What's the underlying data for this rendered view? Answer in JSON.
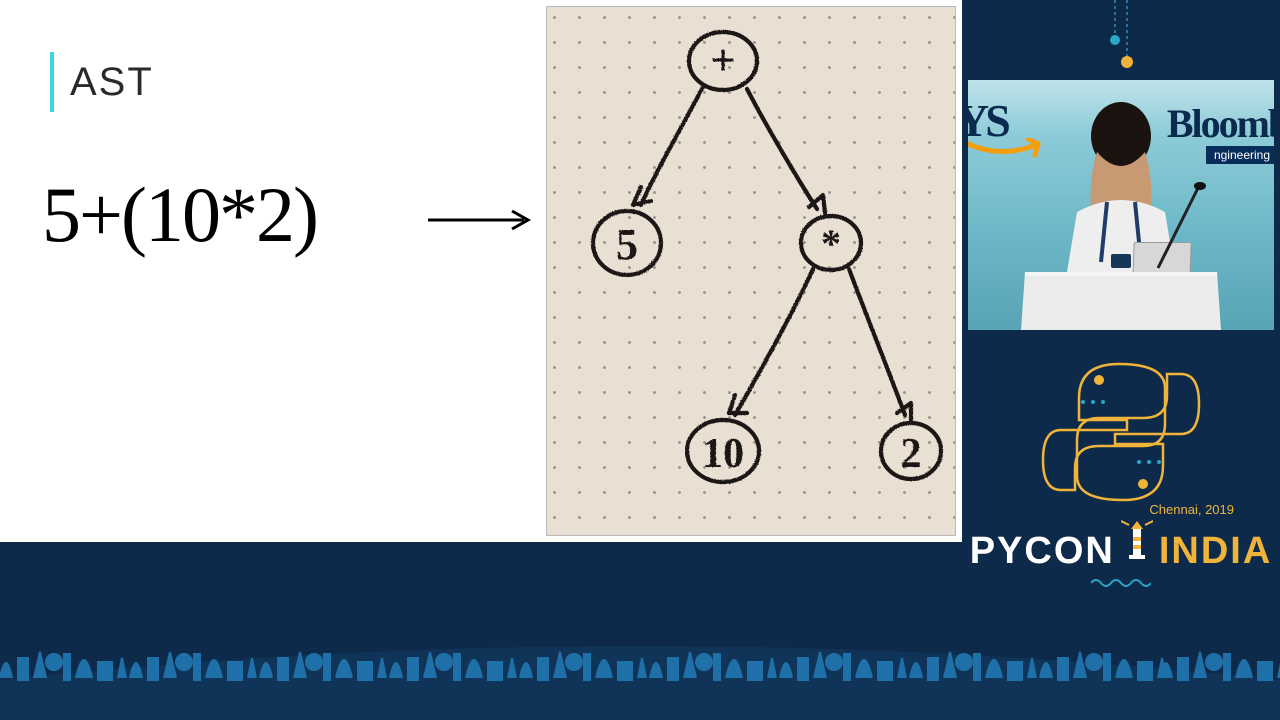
{
  "slide": {
    "title": "AST",
    "expression": "5+(10*2)",
    "tree": {
      "root": "+",
      "left": "5",
      "right": "*",
      "right_left": "10",
      "right_right": "2"
    }
  },
  "sponsors": {
    "left_partial": "YS",
    "right_partial": "Bloombe",
    "right_tag": "ngineering"
  },
  "event": {
    "location_year": "Chennai,  2019",
    "name_left": "PYCON",
    "name_right": "INDIA"
  },
  "colors": {
    "bg": "#0e2a4a",
    "accent_cyan": "#3dd6e0",
    "accent_yellow": "#f0b43a"
  }
}
